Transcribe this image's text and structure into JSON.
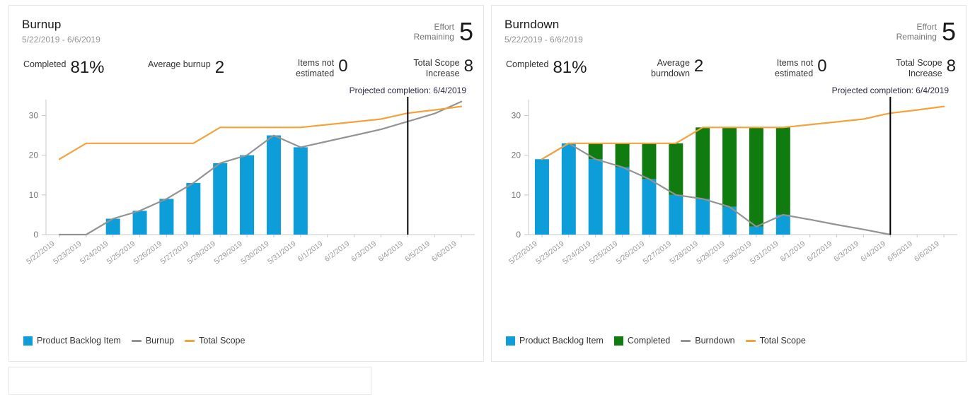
{
  "colors": {
    "blue": "#0d9dd9",
    "green": "#107c10",
    "gray": "#939393",
    "orange": "#f2a33c",
    "marker": "#000000",
    "card_border": "#e6e6e6",
    "axis": "#c8c8c8"
  },
  "cards": [
    {
      "id": "burnup",
      "title": "Burnup",
      "subtitle": "5/22/2019 - 6/6/2019",
      "header_kpi": {
        "label_line1": "Effort",
        "label_line2": "Remaining",
        "value": "5"
      },
      "kpis": [
        {
          "label_line1": "Completed",
          "label_line2": "",
          "value": "81%",
          "align": "left"
        },
        {
          "label_line1": "Average burnup",
          "label_line2": "",
          "value": "2",
          "align": "left"
        },
        {
          "label_line1": "Items not",
          "label_line2": "estimated",
          "value": "0",
          "align": "right"
        },
        {
          "label_line1": "Total Scope",
          "label_line2": "Increase",
          "value": "8",
          "align": "right"
        }
      ],
      "projection_label": "Projected completion: 6/4/2019",
      "legend": [
        {
          "type": "swatch",
          "color": "#0d9dd9",
          "label": "Product Backlog Item"
        },
        {
          "type": "line",
          "color": "#939393",
          "label": "Burnup"
        },
        {
          "type": "line",
          "color": "#f2a33c",
          "label": "Total Scope"
        }
      ]
    },
    {
      "id": "burndown",
      "title": "Burndown",
      "subtitle": "5/22/2019 - 6/6/2019",
      "header_kpi": {
        "label_line1": "Effort",
        "label_line2": "Remaining",
        "value": "5"
      },
      "kpis": [
        {
          "label_line1": "Completed",
          "label_line2": "",
          "value": "81%",
          "align": "left"
        },
        {
          "label_line1": "Average",
          "label_line2": "burndown",
          "value": "2",
          "align": "right"
        },
        {
          "label_line1": "Items not",
          "label_line2": "estimated",
          "value": "0",
          "align": "right"
        },
        {
          "label_line1": "Total Scope",
          "label_line2": "Increase",
          "value": "8",
          "align": "right"
        }
      ],
      "projection_label": "Projected completion: 6/4/2019",
      "legend": [
        {
          "type": "swatch",
          "color": "#0d9dd9",
          "label": "Product Backlog Item"
        },
        {
          "type": "swatch",
          "color": "#107c10",
          "label": "Completed"
        },
        {
          "type": "line",
          "color": "#939393",
          "label": "Burndown"
        },
        {
          "type": "line",
          "color": "#f2a33c",
          "label": "Total Scope"
        }
      ]
    }
  ],
  "chart_data": [
    {
      "type": "bar",
      "id": "burnup",
      "title": "Burnup",
      "subtitle": "5/22/2019 - 6/6/2019",
      "xlabel": "",
      "ylabel": "",
      "ylim": [
        0,
        34
      ],
      "yticks": [
        0,
        10,
        20,
        30
      ],
      "grid": false,
      "legend_position": "bottom-left",
      "categories": [
        "5/22/2019",
        "5/23/2019",
        "5/24/2019",
        "5/25/2019",
        "5/26/2019",
        "5/27/2019",
        "5/28/2019",
        "5/29/2019",
        "5/30/2019",
        "5/31/2019",
        "6/1/2019",
        "6/2/2019",
        "6/3/2019",
        "6/4/2019",
        "6/5/2019",
        "6/6/2019"
      ],
      "series": [
        {
          "name": "Product Backlog Item",
          "kind": "bar",
          "color": "#0d9dd9",
          "values": [
            0,
            0,
            4,
            6,
            9,
            13,
            18,
            20,
            25,
            22,
            null,
            null,
            null,
            null,
            null,
            null
          ]
        },
        {
          "name": "Burnup",
          "kind": "line",
          "color": "#939393",
          "values": [
            0,
            0,
            4,
            6,
            9,
            13,
            18,
            20,
            25,
            22,
            23.5,
            25,
            26.5,
            28.5,
            30.5,
            33.5
          ]
        },
        {
          "name": "Total Scope",
          "kind": "line",
          "color": "#f2a33c",
          "values": [
            19,
            23,
            23,
            23,
            23,
            23,
            27,
            27,
            27,
            27,
            27.7,
            28.4,
            29.1,
            30.6,
            31.4,
            32.3
          ]
        }
      ],
      "annotations": [
        {
          "kind": "vline",
          "x": "6/4/2019",
          "color": "#000000",
          "label": "Projected completion: 6/4/2019"
        }
      ]
    },
    {
      "type": "bar",
      "id": "burndown",
      "title": "Burndown",
      "subtitle": "5/22/2019 - 6/6/2019",
      "xlabel": "",
      "ylabel": "",
      "ylim": [
        0,
        34
      ],
      "yticks": [
        0,
        10,
        20,
        30
      ],
      "grid": false,
      "stacked": true,
      "legend_position": "bottom-left",
      "categories": [
        "5/22/2019",
        "5/23/2019",
        "5/24/2019",
        "5/25/2019",
        "5/26/2019",
        "5/27/2019",
        "5/28/2019",
        "5/29/2019",
        "5/30/2019",
        "5/31/2019",
        "6/1/2019",
        "6/2/2019",
        "6/3/2019",
        "6/4/2019",
        "6/5/2019",
        "6/6/2019"
      ],
      "series": [
        {
          "name": "Product Backlog Item",
          "kind": "bar",
          "color": "#0d9dd9",
          "values": [
            19,
            23,
            19,
            17,
            14,
            10,
            9,
            7,
            2,
            5,
            null,
            null,
            null,
            null,
            null,
            null
          ]
        },
        {
          "name": "Completed",
          "kind": "bar",
          "color": "#107c10",
          "values": [
            0,
            0,
            4,
            6,
            9,
            13,
            18,
            20,
            25,
            22,
            null,
            null,
            null,
            null,
            null,
            null
          ]
        },
        {
          "name": "Burndown",
          "kind": "line",
          "color": "#939393",
          "values": [
            19,
            23,
            19,
            17,
            14,
            10,
            9,
            7,
            2,
            5,
            3.8,
            2.5,
            1.3,
            0,
            null,
            null
          ]
        },
        {
          "name": "Total Scope",
          "kind": "line",
          "color": "#f2a33c",
          "values": [
            19,
            23,
            23,
            23,
            23,
            23,
            27,
            27,
            27,
            27,
            27.7,
            28.4,
            29.1,
            30.6,
            31.4,
            32.3
          ]
        }
      ],
      "annotations": [
        {
          "kind": "vline",
          "x": "6/4/2019",
          "color": "#000000",
          "label": "Projected completion: 6/4/2019"
        }
      ]
    }
  ]
}
